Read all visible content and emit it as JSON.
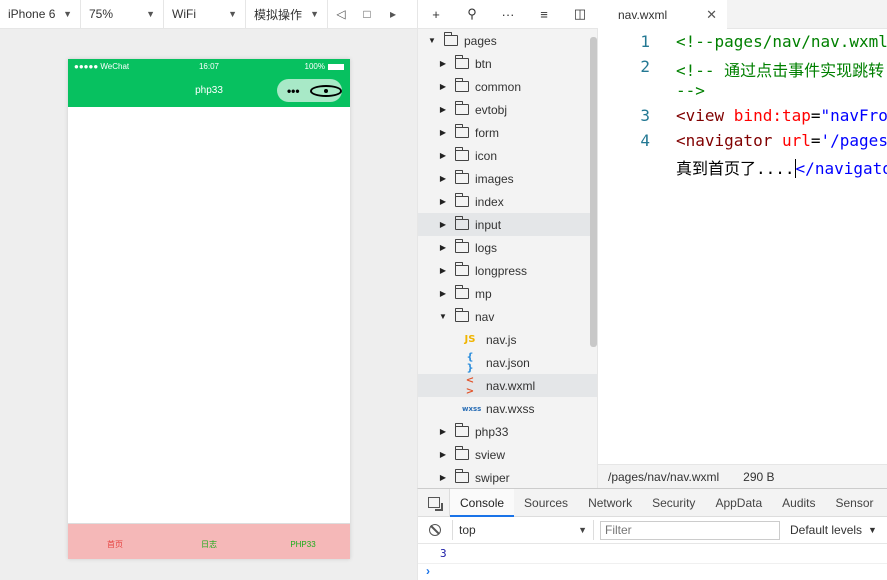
{
  "simulator_toolbar": {
    "device": "iPhone 6",
    "zoom": "75%",
    "network": "WiFi",
    "operation": "模拟操作",
    "icons": [
      "volume-icon",
      "screen-icon",
      "detach-icon"
    ]
  },
  "phone": {
    "status_bar": {
      "carrier": "●●●●● WeChat",
      "time": "16:07",
      "battery": "100%"
    },
    "nav_title": "php33",
    "capsule": {
      "menu": "•••"
    },
    "tab_bar": {
      "items": [
        {
          "label": "首页",
          "color": "#e64340"
        },
        {
          "label": "日志",
          "color": "#1aad19"
        },
        {
          "label": "PHP33",
          "color": "#1aad19"
        }
      ]
    },
    "colors": {
      "nav": "#07c160",
      "tab_bar_bg": "#f5b8b8"
    }
  },
  "explorer": {
    "toolbar_icons": [
      "add-icon",
      "search-icon",
      "more-icon",
      "collapse-icon",
      "split-icon"
    ],
    "items": [
      {
        "label": "pages",
        "type": "folder",
        "open": true
      },
      {
        "label": "btn",
        "type": "folder"
      },
      {
        "label": "common",
        "type": "folder"
      },
      {
        "label": "evtobj",
        "type": "folder"
      },
      {
        "label": "form",
        "type": "folder"
      },
      {
        "label": "icon",
        "type": "folder"
      },
      {
        "label": "images",
        "type": "folder"
      },
      {
        "label": "index",
        "type": "folder"
      },
      {
        "label": "input",
        "type": "folder",
        "hover": true
      },
      {
        "label": "logs",
        "type": "folder"
      },
      {
        "label": "longpress",
        "type": "folder"
      },
      {
        "label": "mp",
        "type": "folder"
      },
      {
        "label": "nav",
        "type": "folder",
        "open": true
      },
      {
        "label": "nav.js",
        "type": "js",
        "glyph": "JS"
      },
      {
        "label": "nav.json",
        "type": "json",
        "glyph": "{ }"
      },
      {
        "label": "nav.wxml",
        "type": "wxml",
        "glyph": "< >",
        "selected": true
      },
      {
        "label": "nav.wxss",
        "type": "wxss",
        "glyph": "wxss"
      },
      {
        "label": "php33",
        "type": "folder"
      },
      {
        "label": "sview",
        "type": "folder"
      },
      {
        "label": "swiper",
        "type": "folder"
      }
    ]
  },
  "editor": {
    "tab_label": "nav.wxml",
    "lines": [
      {
        "num": "1",
        "text": "<!--pages/nav/nav.wxml-->"
      },
      {
        "num": "2",
        "text": "<!-- 通过点击事件实现跳转"
      },
      {
        "num": "",
        "text": "-->"
      },
      {
        "num": "3",
        "text_tag_open": "<view ",
        "attr": "bind:tap",
        "eq": "=",
        "val": "\"navFromEvent\""
      },
      {
        "num": "4",
        "text_tag_open": "<navigator ",
        "attr": "url",
        "eq": "=",
        "val": "'/pages/index/index'"
      },
      {
        "num": "",
        "text_body": "真到首页了....",
        "text_close": "</navigator>"
      }
    ],
    "status_path": "/pages/nav/nav.wxml",
    "status_size": "290 B"
  },
  "console": {
    "tabs": [
      "Console",
      "Sources",
      "Network",
      "Security",
      "AppData",
      "Audits",
      "Sensor"
    ],
    "active_tab": "Console",
    "context": "top",
    "filter_placeholder": "Filter",
    "levels": "Default levels",
    "log": "3",
    "prompt": "›"
  }
}
